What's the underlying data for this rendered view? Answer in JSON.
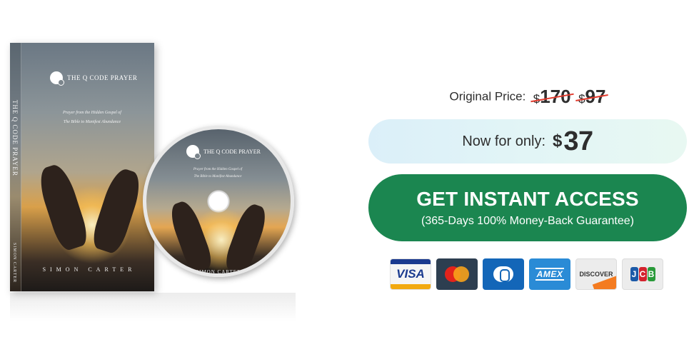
{
  "product": {
    "title": "THE Q CODE PRAYER",
    "subtitle_line1": "Prayer from the Hidden Gospel of",
    "subtitle_line2": "The Bible to Manifest Abundance",
    "author": "SIMON CARTER"
  },
  "pricing": {
    "original_label": "Original Price:",
    "currency": "$",
    "old_price_1": "170",
    "old_price_2": "97",
    "now_label": "Now for only:",
    "now_price": "37"
  },
  "cta": {
    "title": "GET INSTANT ACCESS",
    "subtitle": "(365-Days 100% Money-Back Guarantee)"
  },
  "payment_cards": {
    "visa": "VISA",
    "amex": "AMEX",
    "discover": "DISCOVER",
    "jcb_j": "J",
    "jcb_c": "C",
    "jcb_b": "B",
    "icons": [
      "visa-icon",
      "mastercard-icon",
      "diners-club-icon",
      "amex-icon",
      "discover-icon",
      "jcb-icon"
    ]
  },
  "colors": {
    "cta_green": "#1b8650",
    "strike_red": "#e23b2e",
    "pill_bg": "#dbeff9",
    "text_dark": "#2e2e2e"
  }
}
